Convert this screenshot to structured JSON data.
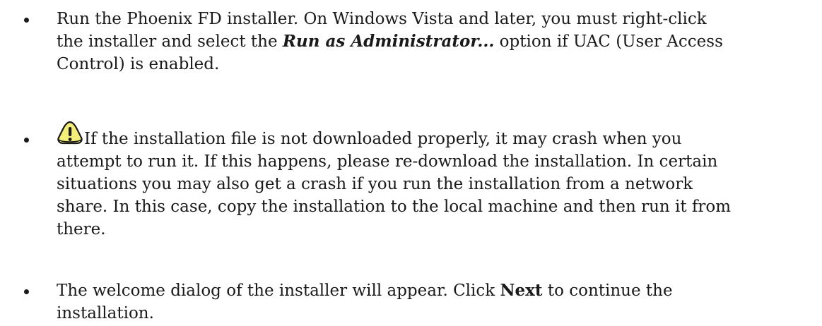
{
  "bullets": [
    {
      "lines": [
        "Run the Phoenix FD installer. On Windows Vista and later, you must right-click",
        "option if UAC (User Access",
        "Control) is enabled."
      ],
      "line2_prefix": "the installer and select the ",
      "line2_emphasis": "Run as Administrator...",
      "line2_suffix": " option if UAC (User Access"
    },
    {
      "line1": "If the installation file is not downloaded properly, it may crash when you",
      "line2": "attempt to run it. If this happens, please re-download the installation. In certain",
      "line3": "situations you may also get a crash if you run the installation from a network",
      "line4": "share. In this case, copy the installation to the local machine and then run it from",
      "line5": "there.",
      "icon": "warning-icon",
      "icon_color": "#f3ee7a"
    },
    {
      "line1_prefix": "The welcome dialog of the installer will appear. Click ",
      "line1_emphasis": "Next",
      "line1_suffix": " to continue the",
      "line2": "installation."
    }
  ]
}
